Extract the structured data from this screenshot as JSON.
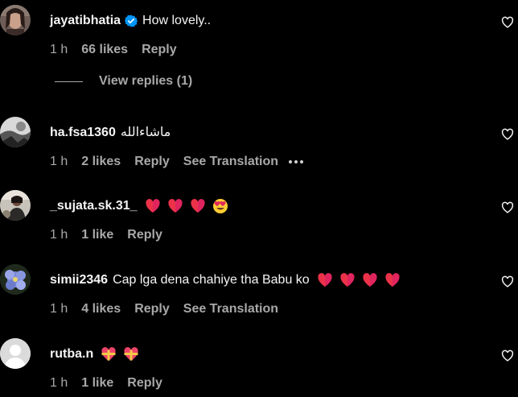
{
  "comments": [
    {
      "username": "jayatibhatia",
      "verified": true,
      "text": "How lovely..",
      "time": "1 h",
      "likes": "66 likes",
      "reply": "Reply",
      "avatar": "avatar-woman-photo",
      "view_replies": "View replies (1)"
    },
    {
      "username": "ha.fsa1360",
      "text": "ماشاءالله",
      "time": "1 h",
      "likes": "2 likes",
      "reply": "Reply",
      "see_translation": "See Translation",
      "avatar": "avatar-black-white-photo"
    },
    {
      "username": "_sujata.sk.31_",
      "text": "",
      "emojis": [
        "red-heart",
        "red-heart",
        "red-heart",
        "heart-eyes"
      ],
      "time": "1 h",
      "likes": "1 like",
      "reply": "Reply",
      "avatar": "avatar-person-photo"
    },
    {
      "username": "simii2346",
      "text": "Cap lga dena chahiye tha Babu ko",
      "emojis": [
        "red-heart",
        "red-heart",
        "red-heart",
        "red-heart"
      ],
      "time": "1 h",
      "likes": "4 likes",
      "reply": "Reply",
      "see_translation": "See Translation",
      "avatar": "avatar-flower-photo"
    },
    {
      "username": "rutba.n",
      "text": "",
      "emojis": [
        "heart-ribbon",
        "heart-ribbon"
      ],
      "time": "1 h",
      "likes": "1 like",
      "reply": "Reply",
      "avatar": "default-avatar"
    }
  ],
  "colors": {
    "background": "#000000",
    "text": "#f5f5f5",
    "secondary": "#a8a8a8",
    "verified": "#0095f6",
    "heart": "#e0245e"
  }
}
